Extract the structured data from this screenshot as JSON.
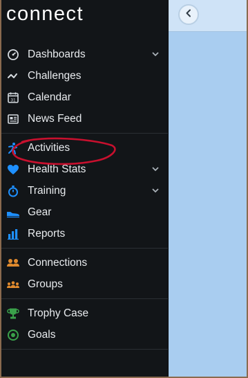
{
  "brand": {
    "logo_text": "connect"
  },
  "nav": {
    "sections": [
      {
        "items": [
          {
            "label": "Dashboards",
            "icon": "dashboard-gauge-icon",
            "has_submenu": true
          },
          {
            "label": "Challenges",
            "icon": "challenges-zigzag-icon",
            "has_submenu": false
          },
          {
            "label": "Calendar",
            "icon": "calendar-icon",
            "has_submenu": false,
            "icon_text": "31"
          },
          {
            "label": "News Feed",
            "icon": "newsfeed-icon",
            "has_submenu": false
          }
        ]
      },
      {
        "items": [
          {
            "label": "Activities",
            "icon": "activity-runner-icon",
            "has_submenu": false
          },
          {
            "label": "Health Stats",
            "icon": "heart-icon",
            "has_submenu": true
          },
          {
            "label": "Training",
            "icon": "stopwatch-icon",
            "has_submenu": true
          },
          {
            "label": "Gear",
            "icon": "shoe-icon",
            "has_submenu": false
          },
          {
            "label": "Reports",
            "icon": "bar-chart-icon",
            "has_submenu": false
          }
        ]
      },
      {
        "items": [
          {
            "label": "Connections",
            "icon": "connections-people-icon",
            "has_submenu": false
          },
          {
            "label": "Groups",
            "icon": "groups-people-icon",
            "has_submenu": false
          }
        ]
      },
      {
        "items": [
          {
            "label": "Trophy Case",
            "icon": "trophy-icon",
            "has_submenu": false
          },
          {
            "label": "Goals",
            "icon": "goal-target-icon",
            "has_submenu": false
          }
        ]
      }
    ]
  },
  "main": {
    "collapse_button_icon": "chevron-left-icon"
  },
  "colors": {
    "sidebar_bg": "#121518",
    "main_bg": "#a9cdf0",
    "annotation_red": "#c8102e",
    "health_blue": "#1e90ff",
    "connections_orange": "#e08a2e",
    "trophy_green": "#3aa14a"
  },
  "annotation": {
    "type": "hand-drawn-circle",
    "target": "Activities",
    "color": "#c8102e"
  }
}
